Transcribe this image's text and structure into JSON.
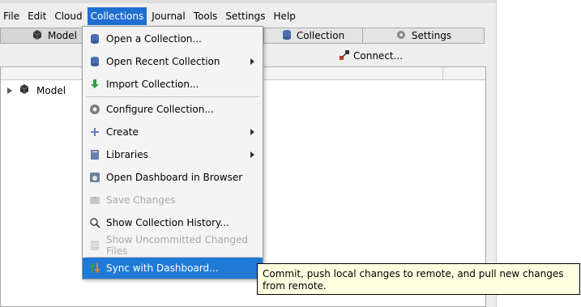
{
  "menubar": {
    "items": [
      {
        "label": "File"
      },
      {
        "label": "Edit"
      },
      {
        "label": "Cloud"
      },
      {
        "label": "Collections"
      },
      {
        "label": "Journal"
      },
      {
        "label": "Tools"
      },
      {
        "label": "Settings"
      },
      {
        "label": "Help"
      }
    ]
  },
  "tabs": [
    {
      "label": "Model",
      "icon": "cube-icon"
    },
    {
      "label": "Collection",
      "icon": "database-icon"
    },
    {
      "label": "Settings",
      "icon": "gear-icon"
    }
  ],
  "toolbar": {
    "connect_label": "Connect..."
  },
  "tree": {
    "rows": [
      {
        "label": "Model"
      }
    ]
  },
  "collections_menu": {
    "items": [
      {
        "label": "Open a Collection...",
        "icon": "database-icon",
        "submenu": false,
        "enabled": true
      },
      {
        "label": "Open Recent Collection",
        "icon": "database-icon",
        "submenu": true,
        "enabled": true
      },
      {
        "label": "Import Collection...",
        "icon": "import-icon",
        "submenu": false,
        "enabled": true
      },
      {
        "label": "Configure Collection...",
        "icon": "gear-icon",
        "submenu": false,
        "enabled": true
      },
      {
        "label": "Create",
        "icon": "plus-icon",
        "submenu": true,
        "enabled": true
      },
      {
        "label": "Libraries",
        "icon": "book-icon",
        "submenu": true,
        "enabled": true
      },
      {
        "label": "Open Dashboard in Browser",
        "icon": "dashboard-icon",
        "submenu": false,
        "enabled": true
      },
      {
        "label": "Save Changes",
        "icon": "save-icon",
        "submenu": false,
        "enabled": false
      },
      {
        "label": "Show Collection History...",
        "icon": "search-icon",
        "submenu": false,
        "enabled": true
      },
      {
        "label": "Show Uncommitted Changed Files",
        "icon": "file-icon",
        "submenu": false,
        "enabled": false
      },
      {
        "label": "Sync with Dashboard...",
        "icon": "sync-icon",
        "submenu": false,
        "enabled": true,
        "highlighted": true
      }
    ]
  },
  "tooltip": {
    "text": "Commit, push local changes to remote, and pull new changes from remote."
  }
}
